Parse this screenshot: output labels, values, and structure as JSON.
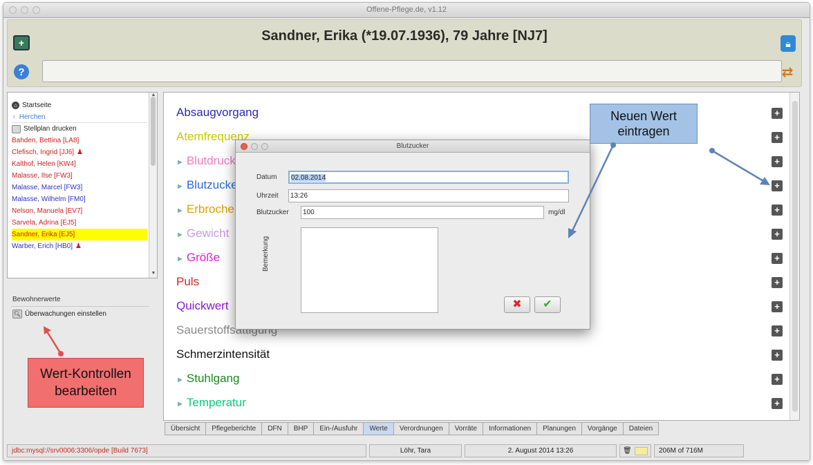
{
  "window": {
    "title": "Offene-Pflege.de, v1.12"
  },
  "header": {
    "patient": "Sandner, Erika (*19.07.1936), 79 Jahre [NJ7]",
    "search_value": ""
  },
  "left": {
    "home": "Startseite",
    "station": "Herchen",
    "print": "Stellplan drucken",
    "residents": [
      {
        "name": "Bahden, Bettina [LA8]",
        "color": "#d02020",
        "mark": ""
      },
      {
        "name": "Clefisch, Ingrid [JJ6]",
        "color": "#d02020",
        "mark": "♟"
      },
      {
        "name": "Kalthof, Helen [KW4]",
        "color": "#d02020",
        "mark": ""
      },
      {
        "name": "Malasse, Ilse [FW3]",
        "color": "#d02020",
        "mark": ""
      },
      {
        "name": "Malasse, Marcel [FW3]",
        "color": "#3030c8",
        "mark": ""
      },
      {
        "name": "Malasse, Wilhelm [FM0]",
        "color": "#3030c8",
        "mark": ""
      },
      {
        "name": "Nelson, Manuela [EV7]",
        "color": "#d02020",
        "mark": ""
      },
      {
        "name": "Sarvela, Adrina [EJ5]",
        "color": "#d02020",
        "mark": ""
      },
      {
        "name": "Sandner, Erika [EJ5]",
        "color": "#d02020",
        "mark": ""
      },
      {
        "name": "Warber, Erich [HB0]",
        "color": "#3030c8",
        "mark": "♟"
      }
    ],
    "section_title": "Bewohnerwerte",
    "section_item": "Überwachungen einstellen"
  },
  "values": [
    {
      "label": "Absaugvorgang",
      "color": "#2a2ab8",
      "expand": false
    },
    {
      "label": "Atemfrequenz",
      "color": "#c8c800",
      "expand": false
    },
    {
      "label": "Blutdruck",
      "color": "#f07ac0",
      "expand": true
    },
    {
      "label": "Blutzucker",
      "color": "#2a6ad8",
      "expand": true
    },
    {
      "label": "Erbrochenes",
      "color": "#e0a000",
      "expand": true
    },
    {
      "label": "Gewicht",
      "color": "#c69ae8",
      "expand": true
    },
    {
      "label": "Größe",
      "color": "#e020d0",
      "expand": true
    },
    {
      "label": "Puls",
      "color": "#e02020",
      "expand": false
    },
    {
      "label": "Quickwert",
      "color": "#8a18d8",
      "expand": false
    },
    {
      "label": "Sauerstoffsättigung",
      "color": "#8a8a8a",
      "expand": false
    },
    {
      "label": "Schmerzintensität",
      "color": "#111111",
      "expand": false
    },
    {
      "label": "Stuhlgang",
      "color": "#1a8a1a",
      "expand": true
    },
    {
      "label": "Temperatur",
      "color": "#10c878",
      "expand": true
    }
  ],
  "tabs": [
    {
      "label": "Übersicht",
      "active": false
    },
    {
      "label": "Pflegeberichte",
      "active": false
    },
    {
      "label": "DFN",
      "active": false
    },
    {
      "label": "BHP",
      "active": false
    },
    {
      "label": "Ein-/Ausfuhr",
      "active": false
    },
    {
      "label": "Werte",
      "active": true
    },
    {
      "label": "Verordnungen",
      "active": false
    },
    {
      "label": "Vorräte",
      "active": false
    },
    {
      "label": "Informationen",
      "active": false
    },
    {
      "label": "Planungen",
      "active": false
    },
    {
      "label": "Vorgänge",
      "active": false
    },
    {
      "label": "Dateien",
      "active": false
    }
  ],
  "status": {
    "db": "jdbc:mysql://srv0006:3306/opde [Build 7673]",
    "user": "Löhr, Tara",
    "date": "2. August 2014 13:26",
    "memory": "206M of 716M"
  },
  "dialog": {
    "title": "Blutzucker",
    "datum_label": "Datum",
    "datum_value": "02.08.2014",
    "uhrzeit_label": "Uhrzeit",
    "uhrzeit_value": "13:26",
    "blutzucker_label": "Blutzucker",
    "blutzucker_value": "100",
    "unit": "mg/dl",
    "bemerkung_label": "Bemerkung"
  },
  "callouts": {
    "new_value_line1": "Neuen Wert",
    "new_value_line2": "eintragen",
    "edit_line1": "Wert-Kontrollen",
    "edit_line2": "bearbeiten"
  },
  "colors": {
    "header_bg": "#dcdccb",
    "selected_row": "#ffff00",
    "callout_blue": "#a3c2e6",
    "callout_red": "#f26f6f"
  }
}
